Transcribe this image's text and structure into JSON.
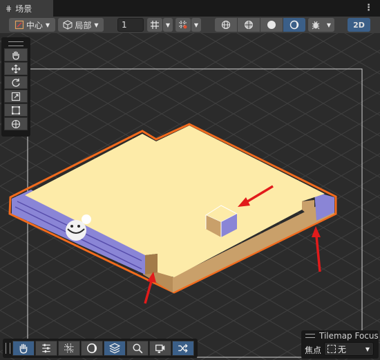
{
  "window": {
    "tab_label": "场景"
  },
  "toolbar": {
    "pivot_label": "中心",
    "space_label": "局部",
    "snap_value": "1",
    "mode_2d_label": "2D",
    "colors": {
      "active": "#3b5f88"
    }
  },
  "tools": {
    "items": [
      "hand-tool",
      "move-tool",
      "rotate-tool",
      "scale-tool",
      "rect-tool",
      "transform-tool"
    ]
  },
  "tilemap_focus": {
    "title": "Tilemap Focus",
    "label": "焦点",
    "value": "无"
  },
  "scene": {
    "tile_top_color": "#fdeba8",
    "tile_side_color": "#c9a06a",
    "highlight_color": "#f26b1d",
    "arrow_color": "#e11b1b",
    "wall_color": "#8a85d6"
  }
}
